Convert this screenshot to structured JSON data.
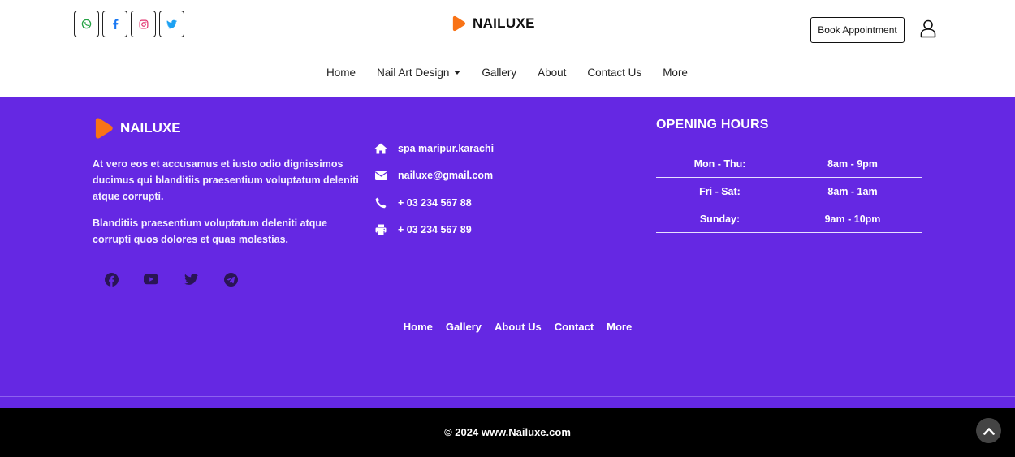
{
  "header": {
    "brand": "NAILUXE",
    "book_label": "Book Appointment",
    "social_icons": [
      "whatsapp-icon",
      "facebook-icon",
      "instagram-icon",
      "twitter-icon"
    ],
    "nav": [
      {
        "label": "Home"
      },
      {
        "label": "Nail Art Design",
        "dropdown": true
      },
      {
        "label": "Gallery"
      },
      {
        "label": "About"
      },
      {
        "label": "Contact Us"
      },
      {
        "label": "More"
      }
    ]
  },
  "footer": {
    "brand": "NAILUXE",
    "paragraph1": "At vero eos et accusamus et iusto odio dignissimos ducimus qui blanditiis praesentium voluptatum deleniti atque corrupti.",
    "paragraph2": "Blanditiis praesentium voluptatum deleniti atque corrupti quos dolores et quas molestias.",
    "social_icons": [
      "facebook-icon",
      "youtube-icon",
      "twitter-icon",
      "telegram-icon"
    ],
    "contact": {
      "address": "spa maripur.karachi",
      "email": "nailuxe@gmail.com",
      "phone": "+ 03 234 567 88",
      "fax": "+ 03 234 567 89"
    },
    "hours": {
      "title": "OPENING HOURS",
      "rows": [
        {
          "day": "Mon - Thu:",
          "time": "8am - 9pm"
        },
        {
          "day": "Fri - Sat:",
          "time": "8am - 1am"
        },
        {
          "day": "Sunday:",
          "time": "9am - 10pm"
        }
      ]
    },
    "links": [
      "Home",
      "Gallery",
      "About Us",
      "Contact",
      "More"
    ],
    "copyright": "© 2024 www.Nailuxe.com"
  },
  "colors": {
    "accent": "#6528e3",
    "logo": "#f97316",
    "bottom_bar": "#000000"
  }
}
